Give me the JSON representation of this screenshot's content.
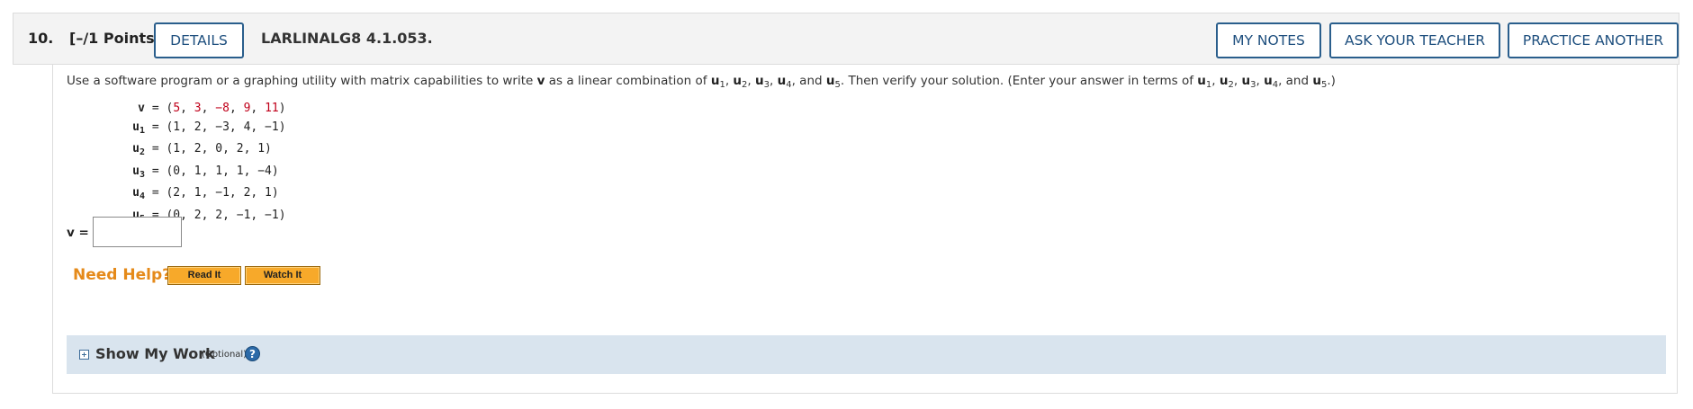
{
  "header": {
    "question_number": "10.",
    "points": "[–/1 Points]",
    "details_label": "DETAILS",
    "problem_code": "LARLINALG8 4.1.053.",
    "my_notes_label": "MY NOTES",
    "ask_teacher_label": "ASK YOUR TEACHER",
    "practice_label": "PRACTICE ANOTHER"
  },
  "instructions": {
    "part1": "Use a software program or a graphing utility with matrix capabilities to write ",
    "v": "v",
    "part2": " as a linear combination of ",
    "u": "u",
    "sub1": "1",
    "sub2": "2",
    "sub3": "3",
    "sub4": "4",
    "sub5": "5",
    "comma": ", ",
    "and": ", and ",
    "part3": ". Then verify your solution. (Enter your answer in terms of ",
    "part4": ".)"
  },
  "vectors": {
    "v": {
      "name": "v",
      "eq": " = (",
      "values": [
        "5",
        "3",
        "−8",
        "9",
        "11"
      ],
      "close": ")"
    },
    "u1": {
      "name": "u",
      "sub": "1",
      "text": " = (1, 2, −3, 4, −1)"
    },
    "u2": {
      "name": "u",
      "sub": "2",
      "text": " = (1, 2, 0, 2, 1)"
    },
    "u3": {
      "name": "u",
      "sub": "3",
      "text": " = (0, 1, 1, 1, −4)"
    },
    "u4": {
      "name": "u",
      "sub": "4",
      "text": " = (2, 1, −1, 2, 1)"
    },
    "u5": {
      "name": "u",
      "sub": "5",
      "text": " = (0, 2, 2, −1, −1)"
    }
  },
  "answer": {
    "label": "v =",
    "value": ""
  },
  "help": {
    "label": "Need Help?",
    "read_it": "Read It",
    "watch_it": "Watch It"
  },
  "show_my_work": {
    "title": "Show My Work",
    "optional": "(Optional)",
    "help_glyph": "?"
  },
  "colors": {
    "accent": "#2a5e8c",
    "need_help": "#e58a1a",
    "help_button": "#f7a92a",
    "highlight_values": "#c0001a",
    "show_my_work_bg": "#d9e4ee"
  }
}
